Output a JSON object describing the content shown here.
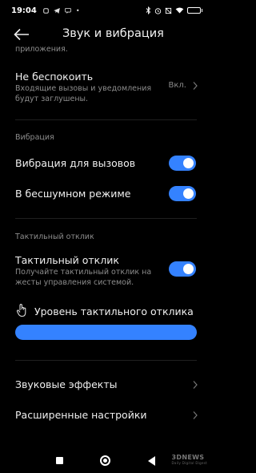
{
  "status": {
    "time": "19:04",
    "battery_level": 0.9,
    "battery_color": "#4cd964"
  },
  "header": {
    "title": "Звук и вибрация"
  },
  "cut_text": "приложения.",
  "dnd": {
    "title": "Не беспокоить",
    "subtitle": "Входящие вызовы и уведомления будут заглушены.",
    "value": "Вкл."
  },
  "vibration": {
    "section_label": "Вибрация",
    "calls": {
      "title": "Вибрация для вызовов",
      "on": true
    },
    "silent": {
      "title": "В бесшумном режиме",
      "on": true
    }
  },
  "haptic": {
    "section_label": "Тактильный отклик",
    "toggle": {
      "title": "Тактильный отклик",
      "subtitle": "Получайте тактильный отклик на жесты управления системой.",
      "on": true
    },
    "level": {
      "title": "Уровень тактильного отклика",
      "value": 1.0
    }
  },
  "sound_effects": {
    "title": "Звуковые эффекты"
  },
  "advanced": {
    "title": "Расширенные настройки"
  },
  "watermark": {
    "brand": "3DNEWS",
    "tagline": "Daily Digital Digest"
  },
  "colors": {
    "accent": "#3482ff",
    "background": "#000000"
  }
}
